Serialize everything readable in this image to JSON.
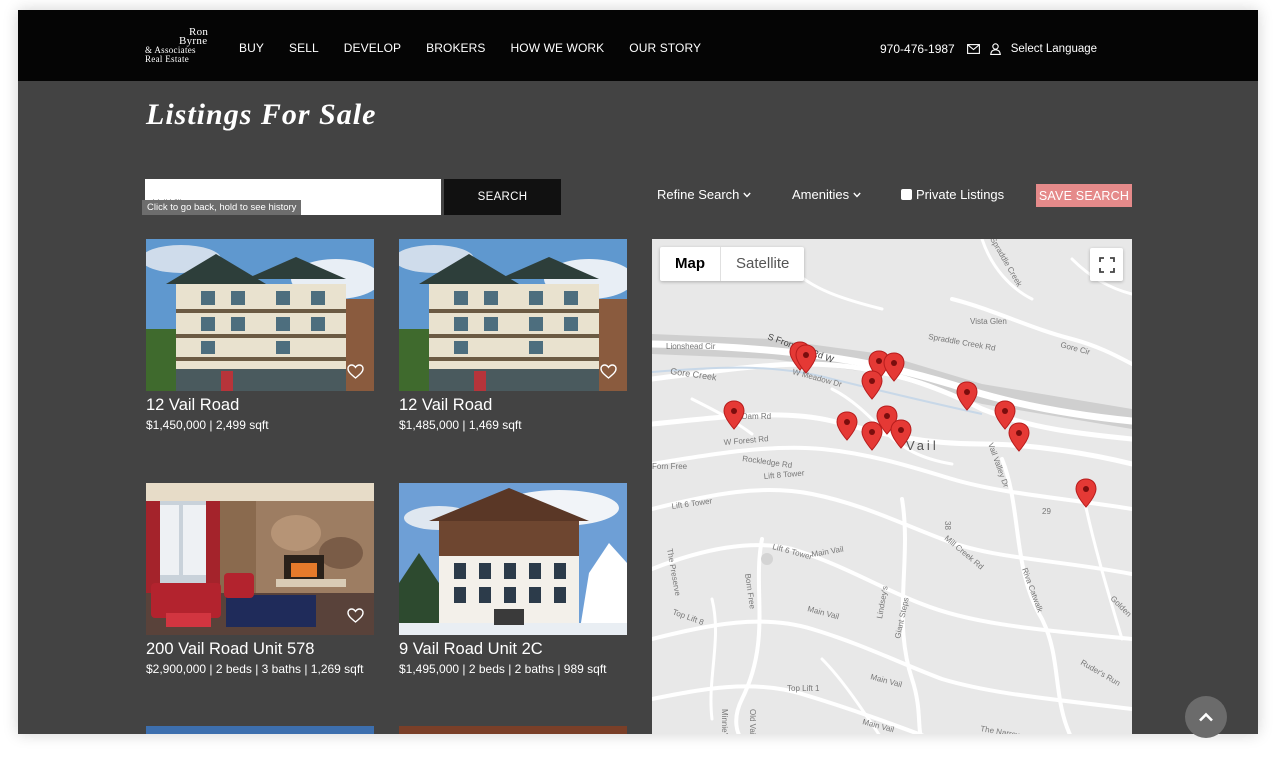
{
  "header": {
    "logo_lines": [
      "Ron",
      "Byrne",
      "& Associates",
      "Real Estate"
    ],
    "nav": [
      "BUY",
      "SELL",
      "DEVELOP",
      "BROKERS",
      "HOW WE WORK",
      "OUR STORY"
    ],
    "phone": "970-476-1987",
    "language": "Select Language"
  },
  "page": {
    "title": "Listings For Sale"
  },
  "search": {
    "value": "Vail Village",
    "tooltip": "Click to go back, hold to see history",
    "button": "SEARCH"
  },
  "filters": {
    "refine": "Refine Search",
    "amenities": "Amenities",
    "private": "Private Listings",
    "save": "SAVE SEARCH"
  },
  "listings": [
    {
      "address": "12 Vail Road",
      "meta": "$1,450,000 | 2,499 sqft",
      "photo_icon": "building-photo"
    },
    {
      "address": "12 Vail Road",
      "meta": "$1,485,000 | 1,469 sqft",
      "photo_icon": "building-photo"
    },
    {
      "address": "200 Vail Road Unit 578",
      "meta": "$2,900,000 | 2 beds | 3 baths | 1,269 sqft",
      "photo_icon": "living-room-photo"
    },
    {
      "address": "9 Vail Road Unit 2C",
      "meta": "$1,495,000 | 2 beds | 2 baths | 989 sqft",
      "photo_icon": "chalet-photo"
    }
  ],
  "map": {
    "tab_map": "Map",
    "tab_satellite": "Satellite",
    "labels": [
      "S Frontage Rd W",
      "W Meadow Dr",
      "Gore Creek",
      "Lionshead Cir",
      "Spraddle Creek Rd",
      "Vail Valley Dr",
      "W Forest Rd",
      "Rockledge Rd",
      "Vail",
      "Lift 8 Tower",
      "Lift 6 Tower",
      "Main Vail",
      "The Preserve",
      "Born Free",
      "Lindsey's",
      "Giant Steps",
      "Mill Creek Rd",
      "Riva Catwalk",
      "Ruder's Run",
      "Top Lift 8",
      "Top Lift 1",
      "The Narrows",
      "Golden",
      "29",
      "38",
      "Vista Glen",
      "Gore Cir",
      "Spraddle Creek",
      "Spaddle Creek",
      "Forn Free",
      "Old Vail",
      "Minnie's",
      "W Dam Rd"
    ],
    "marker_icon": "map-pin-icon"
  }
}
